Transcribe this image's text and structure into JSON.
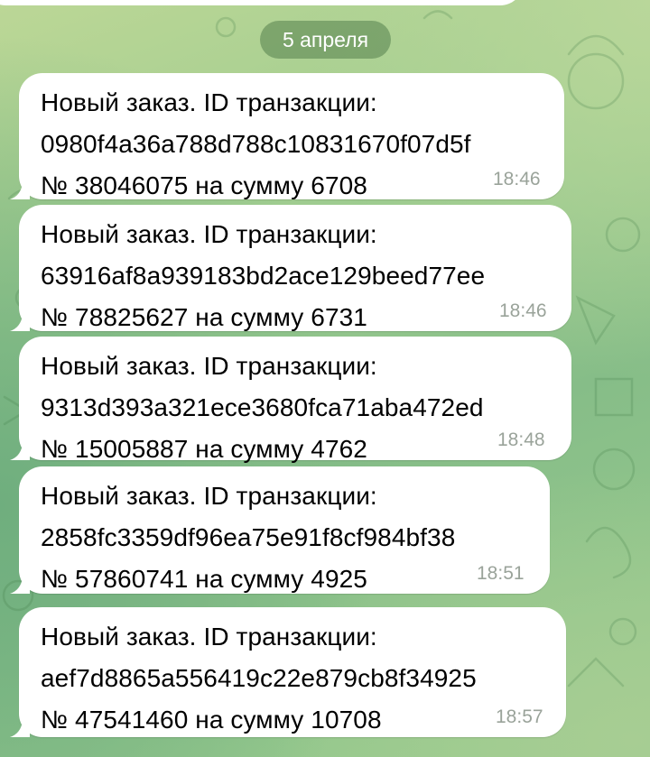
{
  "date_separator": "5 апреля",
  "messages": [
    {
      "line1": "Новый заказ. ID транзакции:",
      "line2": "0980f4a36a788d788c10831670f07d5f",
      "line3": "№ 38046075 на сумму 6708",
      "time": "18:46"
    },
    {
      "line1": "Новый заказ. ID транзакции:",
      "line2": "63916af8a939183bd2ace129beed77ee",
      "line3": "№ 78825627 на сумму 6731",
      "time": "18:46"
    },
    {
      "line1": "Новый заказ. ID транзакции:",
      "line2": "9313d393a321ece3680fca71aba472ed",
      "line3": "№ 15005887 на сумму 4762",
      "time": "18:48"
    },
    {
      "line1": "Новый заказ. ID транзакции:",
      "line2": "2858fc3359df96ea75e91f8cf984bf38",
      "line3": "№ 57860741 на сумму 4925",
      "time": "18:51"
    },
    {
      "line1": "Новый заказ. ID транзакции:",
      "line2": "aef7d8865a556419c22e879cb8f34925",
      "line3": "№ 47541460 на сумму 10708",
      "time": "18:57"
    }
  ],
  "colors": {
    "bubble": "#ffffff",
    "timestamp": "#9aa39a",
    "date_pill": "#54804c",
    "wallpaper": "#9ccb8f"
  }
}
